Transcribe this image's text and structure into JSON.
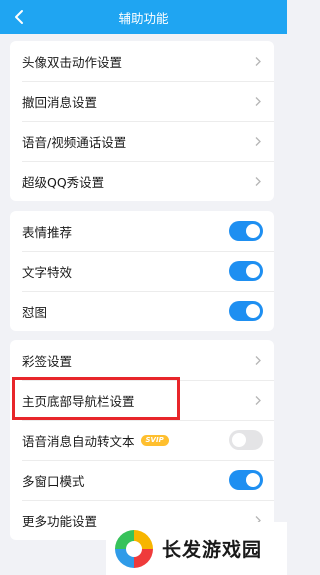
{
  "header": {
    "title": "辅助功能"
  },
  "group1": [
    {
      "label": "头像双击动作设置"
    },
    {
      "label": "撤回消息设置"
    },
    {
      "label": "语音/视频通话设置"
    },
    {
      "label": "超级QQ秀设置"
    }
  ],
  "group2": [
    {
      "label": "表情推荐",
      "enabled": true
    },
    {
      "label": "文字特效",
      "enabled": true
    },
    {
      "label": "怼图",
      "enabled": true
    }
  ],
  "group3": [
    {
      "label": "彩签设置"
    },
    {
      "label": "主页底部导航栏设置"
    },
    {
      "label": "语音消息自动转文本",
      "badge": "SVIP",
      "enabled": false
    },
    {
      "label": "多窗口模式",
      "enabled": true
    },
    {
      "label": "更多功能设置"
    }
  ],
  "watermark": {
    "text": "长发游戏园"
  },
  "colors": {
    "header_bg": "#1fa5f2",
    "toggle_on": "#1e8ff1",
    "toggle_off": "#e4e4e6",
    "highlight": "#e8262a",
    "svip_badge": "#ffbf2e"
  }
}
